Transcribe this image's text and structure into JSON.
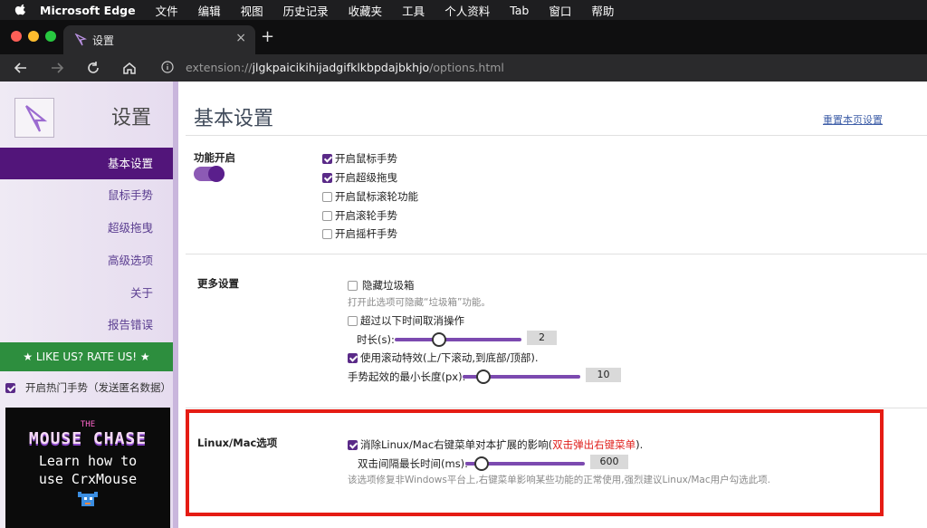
{
  "menubar": {
    "items": [
      "Microsoft Edge",
      "文件",
      "编辑",
      "视图",
      "历史记录",
      "收藏夹",
      "工具",
      "个人资料",
      "Tab",
      "窗口",
      "帮助"
    ]
  },
  "tab": {
    "title": "设置",
    "close": "×",
    "new_tab": "+"
  },
  "address": {
    "scheme": "extension://",
    "host": "jlgkpaicikihijadgifklkbpdajbkhjo",
    "path": "/options.html"
  },
  "sidebar": {
    "title": "设置",
    "items": [
      "基本设置",
      "鼠标手势",
      "超级拖曳",
      "高级选项",
      "关于",
      "报告错误"
    ],
    "active_index": 0,
    "rate_label": "★ LIKE US? RATE US! ★",
    "hot_checkbox": {
      "label": "开启热门手势（发送匿名数据）",
      "checked": true
    },
    "promo": {
      "the": "THE",
      "title": "MOUSE CHASE",
      "line1": "Learn how to",
      "line2": "use CrxMouse"
    }
  },
  "main": {
    "title": "基本设置",
    "reset_link": "重置本页设置",
    "features": {
      "label": "功能开启",
      "toggle_on": true,
      "options": [
        {
          "label": "开启鼠标手势",
          "checked": true
        },
        {
          "label": "开启超级拖曳",
          "checked": true
        },
        {
          "label": "开启鼠标滚轮功能",
          "checked": false
        },
        {
          "label": "开启滚轮手势",
          "checked": false
        },
        {
          "label": "开启摇杆手势",
          "checked": false
        }
      ]
    },
    "more": {
      "label": "更多设置",
      "hide_trash": {
        "label": "隐藏垃圾箱",
        "checked": false,
        "hint": "打开此选项可隐藏“垃圾箱”功能。"
      },
      "cancel_timeout": {
        "label": "超过以下时间取消操作",
        "checked": false
      },
      "duration": {
        "label": "时长(s):",
        "value": "2",
        "level": 0.2
      },
      "scroll_effect": {
        "label": "使用滚动特效(上/下滚动,到底部/顶部).",
        "checked": true
      },
      "min_length": {
        "label": "手势起效的最小长度(px):",
        "value": "10",
        "level": 0.1
      }
    },
    "linux": {
      "label": "Linux/Mac选项",
      "fix": {
        "label": "消除Linux/Mac右键菜单对本扩展的影响(",
        "link": "双击弹出右键菜单",
        "suffix": ").",
        "checked": true
      },
      "interval": {
        "label": "双击间隔最长时间(ms):",
        "value": "600",
        "level": 0.1
      },
      "hint": "该选项修复非Windows平台上,右键菜单影响某些功能的正常使用,强烈建议Linux/Mac用户勾选此项."
    }
  }
}
